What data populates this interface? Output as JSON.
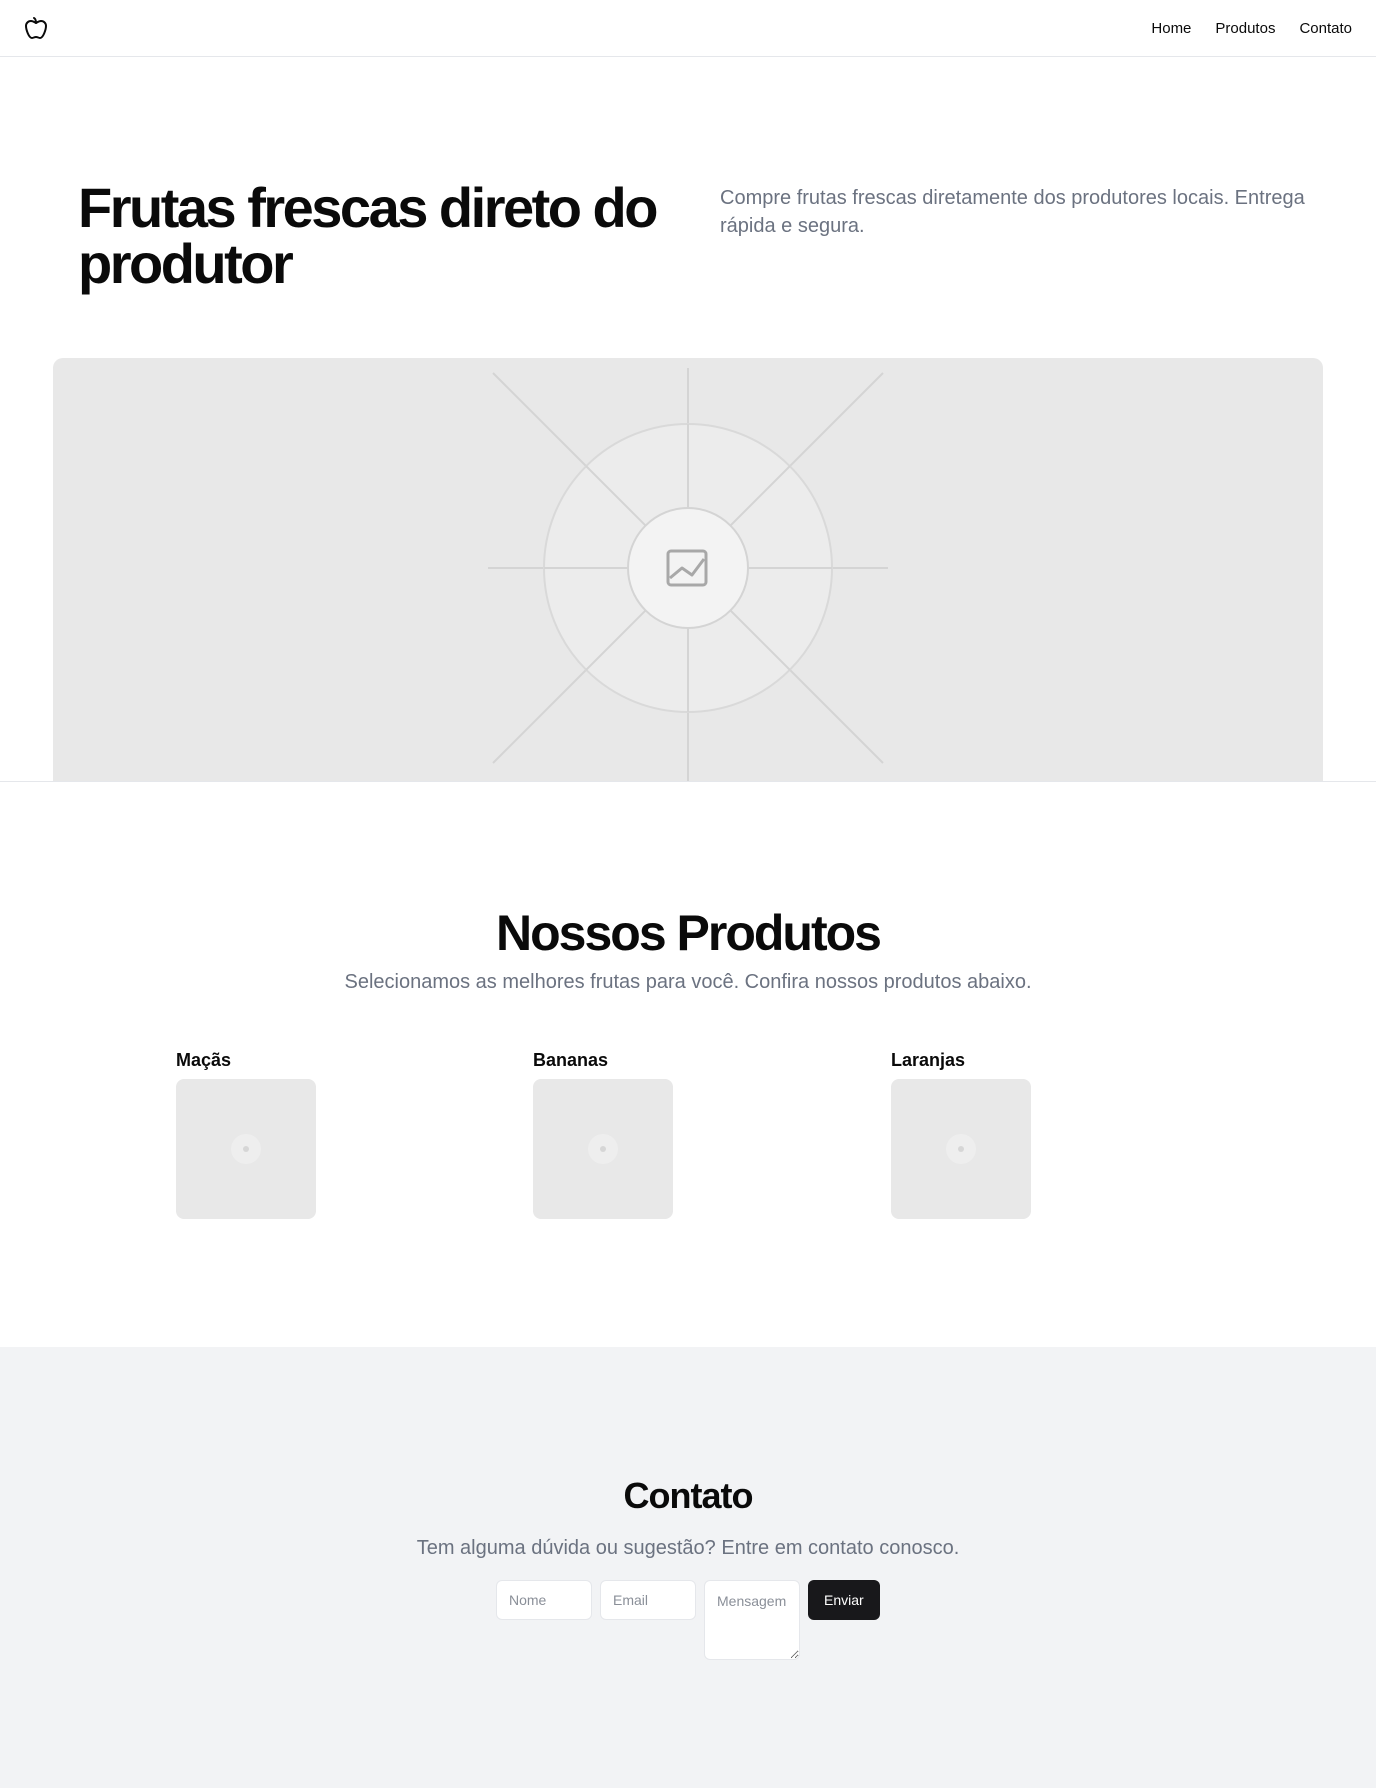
{
  "nav": {
    "logo_icon": "apple-icon",
    "links": [
      {
        "label": "Home"
      },
      {
        "label": "Produtos"
      },
      {
        "label": "Contato"
      }
    ]
  },
  "hero": {
    "title": "Frutas frescas direto do produtor",
    "subtitle": "Compre frutas frescas diretamente dos produtores locais. Entrega rápida e segura.",
    "image_icon": "image-placeholder-icon"
  },
  "products": {
    "title": "Nossos Produtos",
    "subtitle": "Selecionamos as melhores frutas para você. Confira nossos produtos abaixo.",
    "items": [
      {
        "name": "Maçãs"
      },
      {
        "name": "Bananas"
      },
      {
        "name": "Laranjas"
      }
    ]
  },
  "contact": {
    "title": "Contato",
    "subtitle": "Tem alguma dúvida ou sugestão? Entre em contato conosco.",
    "form": {
      "name_placeholder": "Nome",
      "email_placeholder": "Email",
      "message_placeholder": "Mensagem",
      "submit_label": "Enviar"
    }
  },
  "colors": {
    "primary_button": "#18181b",
    "muted_text": "#6b7280",
    "placeholder_bg": "#e8e8e8",
    "contact_bg": "#f2f3f5"
  }
}
